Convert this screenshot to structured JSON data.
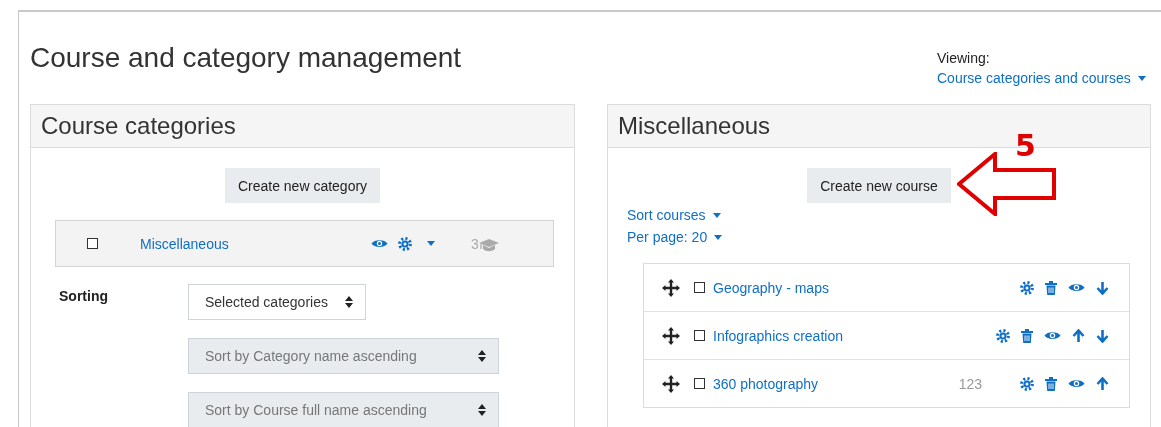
{
  "page": {
    "title": "Course and category management",
    "viewing_label": "Viewing:",
    "viewing_value": "Course categories and courses"
  },
  "categories_panel": {
    "title": "Course categories",
    "create_button": "Create new category",
    "categories": [
      {
        "name": "Miscellaneous",
        "checked": false,
        "course_count": "3"
      }
    ],
    "sorting": {
      "label": "Sorting",
      "selects": [
        {
          "value": "Selected categories",
          "disabled": false
        },
        {
          "value": "Sort by Category name ascending",
          "disabled": true
        },
        {
          "value": "Sort by Course full name ascending",
          "disabled": true
        }
      ]
    }
  },
  "courses_panel": {
    "title": "Miscellaneous",
    "create_button": "Create new course",
    "sort_menu": "Sort courses",
    "per_page_menu": "Per page: 20",
    "courses": [
      {
        "name": "Geography - maps",
        "checked": false,
        "move_up": false,
        "move_down": true
      },
      {
        "name": "Infographics creation",
        "checked": false,
        "move_up": true,
        "move_down": true
      },
      {
        "name": "360 photography",
        "checked": false,
        "count": "123",
        "move_up": true,
        "move_down": false
      }
    ]
  },
  "annotation": {
    "label": "5"
  }
}
